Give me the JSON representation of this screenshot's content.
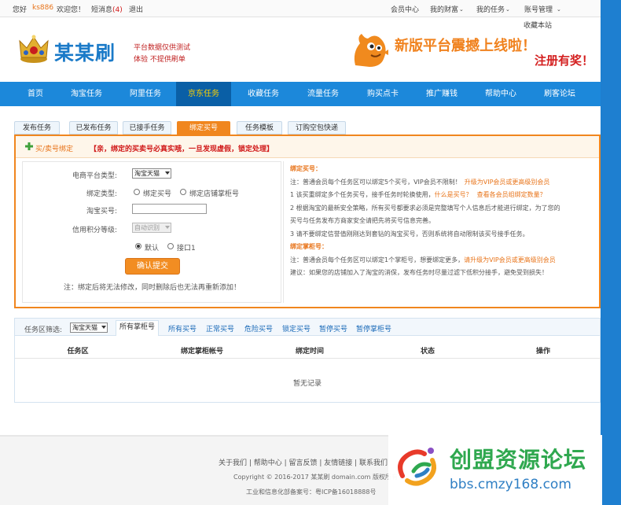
{
  "topbar": {
    "greeting": "您好",
    "username": "ks886",
    "welcome": "欢迎您！",
    "messages": "短消息",
    "message_count": "(4)",
    "logout": "退出",
    "member_center": "会员中心",
    "my_wealth": "我的财富",
    "my_tasks": "我的任务",
    "account_mgmt": "账号管理",
    "favorite": "收藏本站"
  },
  "brand": {
    "name": "某某刷",
    "slogan_line1": "平台数据仅供测试",
    "slogan_line2": "体验  不提供刷单"
  },
  "banner": {
    "headline": "新版平台震撼上线啦！",
    "sub": "注册有奖！"
  },
  "nav": [
    {
      "label": "首页",
      "active": false
    },
    {
      "label": "淘宝任务",
      "active": false
    },
    {
      "label": "阿里任务",
      "active": false
    },
    {
      "label": "京东任务",
      "active": true
    },
    {
      "label": "收藏任务",
      "active": false
    },
    {
      "label": "流量任务",
      "active": false
    },
    {
      "label": "购买点卡",
      "active": false
    },
    {
      "label": "推广赚钱",
      "active": false
    },
    {
      "label": "帮助中心",
      "active": false
    },
    {
      "label": "刷客论坛",
      "active": false
    }
  ],
  "tabs": [
    {
      "label": "发布任务",
      "active": false
    },
    {
      "label": "已发布任务",
      "active": false
    },
    {
      "label": "已接手任务",
      "active": false
    },
    {
      "label": "绑定买号",
      "active": true
    },
    {
      "label": "任务模板",
      "active": false
    },
    {
      "label": "订购空包快递",
      "active": false
    }
  ],
  "panel": {
    "head_label": "买/卖号绑定",
    "head_warning": "【亲，绑定的买卖号必真实哦，一旦发现虚假，锁定处理】"
  },
  "form": {
    "platform_label": "电商平台类型:",
    "platform_value": "淘宝天猫",
    "bind_type_label": "绑定类型:",
    "bind_option_buyer": "绑定买号",
    "bind_option_seller": "绑定店铺掌柜号",
    "buyer_label": "淘宝买号:",
    "buyer_value": "",
    "credit_label": "信用积分等级:",
    "credit_value": "自动识别",
    "option_default": "默认",
    "option_port1": "接口1",
    "submit": "确认提交",
    "note": "注：绑定后将无法修改，同时删除后也无法再重新添加！"
  },
  "info": {
    "buyer_title": "绑定买号：",
    "buyer_line1": "注：普通会员每个任务区可以绑定5个买号，VIP会员不限制！",
    "buyer_line1b": "升级为VIP会员或更高级别会员",
    "buyer_line2": "1 该买重绑定多个任务买号，接手任务时轮换使用，",
    "buyer_line2b": "什么是买号？",
    "buyer_line2c": "查看各会员组绑定数量？",
    "buyer_line3": "2 根据淘宝的最新安全策略，所有买号都要求必须是完整填写个人信息后才能进行绑定，为了您的",
    "buyer_line4": "买号与任务发布方商家安全请把先将买号信息完善。",
    "buyer_line5": "3 请不要绑定信誉值刚刚达到套钻的淘宝买号，否则系统将自动限制该买号接手任务。",
    "seller_title": "绑定掌柜号：",
    "seller_line1": "注：普通会员每个任务区可以绑定1个掌柜号，想要绑定更多，",
    "seller_line1b": "请升级为VIP会员或更高级别会员",
    "seller_line2": "建议：如果您的店铺加入了淘宝的消保，发布任务时尽量过滤下低积分接手，避免受到损失！"
  },
  "list": {
    "filter_label": "任务区筛选:",
    "filter_value": "淘宝天猫",
    "filter_tabs": [
      "所有掌柜号",
      "所有买号",
      "正常买号",
      "危险买号",
      "锁定买号",
      "暂停买号",
      "暂停掌柜号"
    ],
    "columns": [
      "任务区",
      "绑定掌柜帐号",
      "绑定时间",
      "状态",
      "操作"
    ],
    "empty": "暂无记录"
  },
  "footer": {
    "links": "关于我们 | 帮助中心 | 留言反馈 | 友情链接 | 联系我们",
    "copyright": "Copyright © 2016-2017 某某刷  domain.com 版权所有",
    "icp": "工业和信息化部备案号：粤ICP备16018888号"
  },
  "watermark": {
    "title": "创盟资源论坛",
    "url": "bbs.cmzy168.com"
  },
  "colors": {
    "nav_blue": "#1c88da",
    "accent_orange": "#f0861e",
    "warning_red": "#d01818"
  }
}
